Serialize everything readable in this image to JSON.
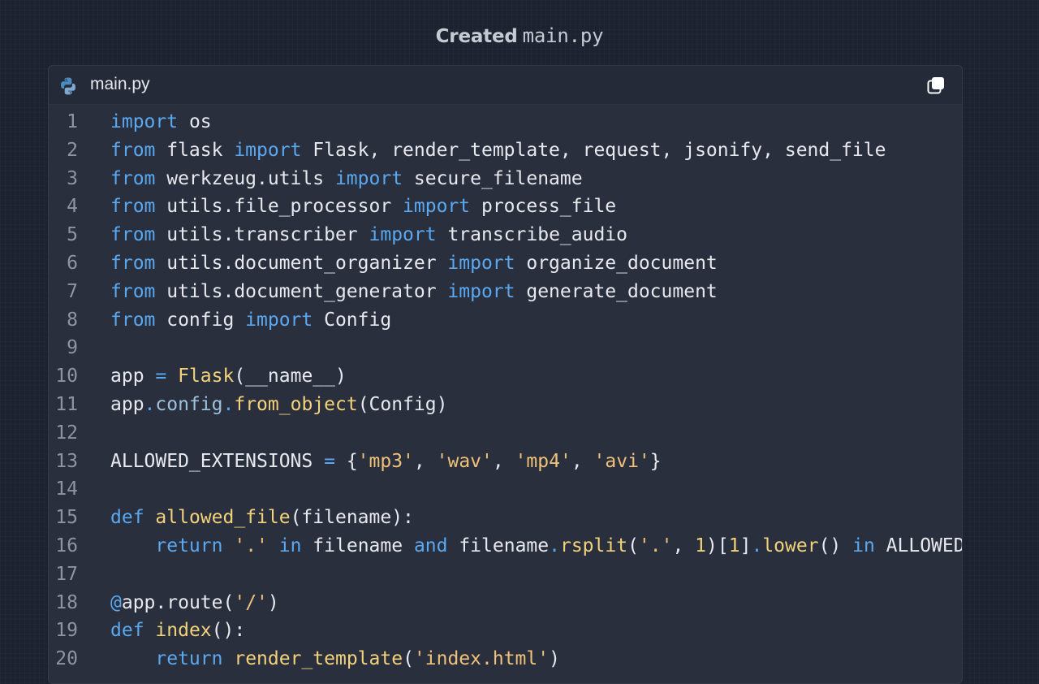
{
  "header": {
    "word": "Created",
    "filename": "main.py"
  },
  "tab": {
    "label": "main.py",
    "icon": "python-icon",
    "copy_icon": "copy-icon"
  },
  "colors": {
    "keyword": "#5aa8f0",
    "function": "#f2d27a",
    "string": "#efc179",
    "text": "#e8e9ee",
    "line_number": "#8e94a3",
    "background": "#2a2f3e"
  },
  "code_lines": [
    {
      "n": "1",
      "tokens": [
        [
          "kw",
          "import"
        ],
        [
          "txt",
          " os"
        ]
      ]
    },
    {
      "n": "2",
      "tokens": [
        [
          "kw",
          "from"
        ],
        [
          "txt",
          " flask "
        ],
        [
          "kw",
          "import"
        ],
        [
          "txt",
          " Flask, render_template, request, jsonify, send_file"
        ]
      ]
    },
    {
      "n": "3",
      "tokens": [
        [
          "kw",
          "from"
        ],
        [
          "txt",
          " werkzeug.utils "
        ],
        [
          "kw",
          "import"
        ],
        [
          "txt",
          " secure_filename"
        ]
      ]
    },
    {
      "n": "4",
      "tokens": [
        [
          "kw",
          "from"
        ],
        [
          "txt",
          " utils.file_processor "
        ],
        [
          "kw",
          "import"
        ],
        [
          "txt",
          " process_file"
        ]
      ]
    },
    {
      "n": "5",
      "tokens": [
        [
          "kw",
          "from"
        ],
        [
          "txt",
          " utils.transcriber "
        ],
        [
          "kw",
          "import"
        ],
        [
          "txt",
          " transcribe_audio"
        ]
      ]
    },
    {
      "n": "6",
      "tokens": [
        [
          "kw",
          "from"
        ],
        [
          "txt",
          " utils.document_organizer "
        ],
        [
          "kw",
          "import"
        ],
        [
          "txt",
          " organize_document"
        ]
      ]
    },
    {
      "n": "7",
      "tokens": [
        [
          "kw",
          "from"
        ],
        [
          "txt",
          " utils.document_generator "
        ],
        [
          "kw",
          "import"
        ],
        [
          "txt",
          " generate_document"
        ]
      ]
    },
    {
      "n": "8",
      "tokens": [
        [
          "kw",
          "from"
        ],
        [
          "txt",
          " config "
        ],
        [
          "kw",
          "import"
        ],
        [
          "txt",
          " Config"
        ]
      ]
    },
    {
      "n": "9",
      "tokens": []
    },
    {
      "n": "10",
      "tokens": [
        [
          "txt",
          "app "
        ],
        [
          "op",
          "="
        ],
        [
          "txt",
          " "
        ],
        [
          "fn",
          "Flask"
        ],
        [
          "txt",
          "(__name__)"
        ]
      ]
    },
    {
      "n": "11",
      "tokens": [
        [
          "txt",
          "app"
        ],
        [
          "op",
          "."
        ],
        [
          "attr",
          "config"
        ],
        [
          "op",
          "."
        ],
        [
          "fn",
          "from_object"
        ],
        [
          "txt",
          "(Config)"
        ]
      ]
    },
    {
      "n": "12",
      "tokens": []
    },
    {
      "n": "13",
      "tokens": [
        [
          "txt",
          "ALLOWED_EXTENSIONS "
        ],
        [
          "op",
          "="
        ],
        [
          "txt",
          " {"
        ],
        [
          "str",
          "'mp3'"
        ],
        [
          "txt",
          ", "
        ],
        [
          "str",
          "'wav'"
        ],
        [
          "txt",
          ", "
        ],
        [
          "str",
          "'mp4'"
        ],
        [
          "txt",
          ", "
        ],
        [
          "str",
          "'avi'"
        ],
        [
          "txt",
          "}"
        ]
      ]
    },
    {
      "n": "14",
      "tokens": []
    },
    {
      "n": "15",
      "tokens": [
        [
          "kw",
          "def"
        ],
        [
          "txt",
          " "
        ],
        [
          "fn",
          "allowed_file"
        ],
        [
          "txt",
          "(filename):"
        ]
      ]
    },
    {
      "n": "16",
      "tokens": [
        [
          "txt",
          "    "
        ],
        [
          "kw",
          "return"
        ],
        [
          "txt",
          " "
        ],
        [
          "str",
          "'.'"
        ],
        [
          "txt",
          " "
        ],
        [
          "kw",
          "in"
        ],
        [
          "txt",
          " filename "
        ],
        [
          "kw",
          "and"
        ],
        [
          "txt",
          " filename"
        ],
        [
          "op",
          "."
        ],
        [
          "fn",
          "rsplit"
        ],
        [
          "txt",
          "("
        ],
        [
          "str",
          "'.'"
        ],
        [
          "txt",
          ", "
        ],
        [
          "num",
          "1"
        ],
        [
          "txt",
          ")["
        ],
        [
          "num",
          "1"
        ],
        [
          "txt",
          "]"
        ],
        [
          "op",
          "."
        ],
        [
          "fn",
          "lower"
        ],
        [
          "txt",
          "() "
        ],
        [
          "kw",
          "in"
        ],
        [
          "txt",
          " ALLOWED_EXTENSIONS"
        ]
      ]
    },
    {
      "n": "17",
      "tokens": []
    },
    {
      "n": "18",
      "tokens": [
        [
          "kw",
          "@"
        ],
        [
          "txt",
          "app.route("
        ],
        [
          "str",
          "'/'"
        ],
        [
          "txt",
          ")"
        ]
      ]
    },
    {
      "n": "19",
      "tokens": [
        [
          "kw",
          "def"
        ],
        [
          "txt",
          " "
        ],
        [
          "fn",
          "index"
        ],
        [
          "txt",
          "():"
        ]
      ]
    },
    {
      "n": "20",
      "tokens": [
        [
          "txt",
          "    "
        ],
        [
          "kw",
          "return"
        ],
        [
          "txt",
          " "
        ],
        [
          "fn",
          "render_template"
        ],
        [
          "txt",
          "("
        ],
        [
          "str",
          "'index.html'"
        ],
        [
          "txt",
          ")"
        ]
      ]
    }
  ]
}
